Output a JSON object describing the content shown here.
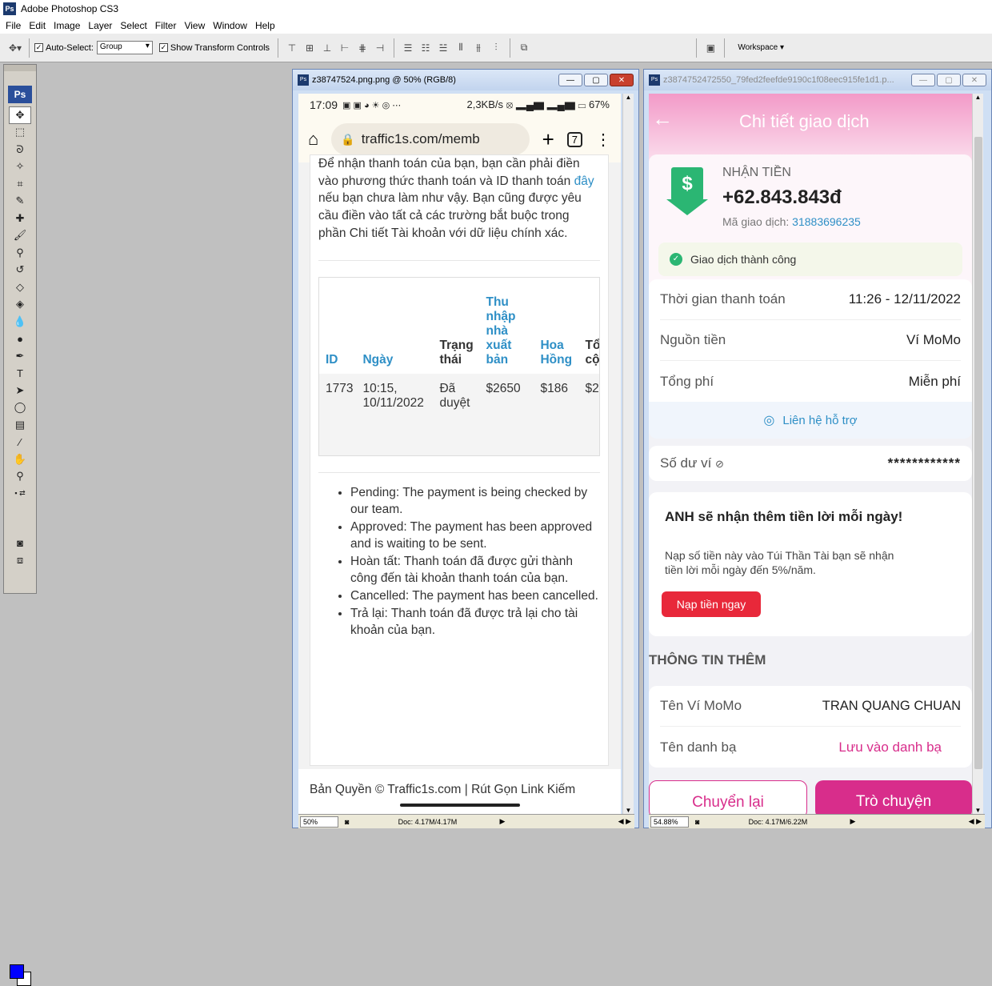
{
  "app": {
    "title": "Adobe Photoshop CS3",
    "logo": "Ps"
  },
  "menu": [
    "File",
    "Edit",
    "Image",
    "Layer",
    "Select",
    "Filter",
    "View",
    "Window",
    "Help"
  ],
  "options": {
    "auto_select_label": "Auto-Select:",
    "auto_select_value": "Group",
    "show_transform_label": "Show Transform Controls",
    "workspace_label": "Workspace ▾"
  },
  "doc1": {
    "title": "z38747524.png.png @ 50% (RGB/8)",
    "zoom": "50%",
    "doc_info": "Doc: 4.17M/4.17M",
    "phone": {
      "time": "17:09",
      "status_right": "2,3KB/s ⦻ ▂▄▆ ▂▄▆ ▭ 67%",
      "url": "traffic1s.com/memb",
      "tabs": "7",
      "intro_1": "Để nhận thanh toán của bạn, bạn cần phải điền vào phương thức thanh toán và ID thanh toán ",
      "intro_link": "đây",
      "intro_2": " nếu bạn chưa làm như vậy. Bạn cũng được yêu cầu điền vào tất cả các trường bắt buộc trong phần Chi tiết Tài khoản với dữ liệu chính xác.",
      "table_headers": [
        "ID",
        "Ngày",
        "Trạng thái",
        "Thu nhập nhà xuất bản",
        "Hoa Hồng",
        "Tổng cộng"
      ],
      "table_row": [
        "1773",
        "10:15, 10/11/2022",
        "Đã duyệt",
        "$2650",
        "$186",
        "$2"
      ],
      "bullets": [
        "Pending: The payment is being checked by our team.",
        "Approved: The payment has been approved and is waiting to be sent.",
        "Hoàn tất: Thanh toán đã được gửi thành công đến tài khoản thanh toán của bạn.",
        "Cancelled: The payment has been cancelled.",
        "Trả lại: Thanh toán đã được trả lại cho tài khoản của bạn."
      ],
      "footer": "Bản Quyền © Traffic1s.com | Rút Gọn Link Kiếm"
    }
  },
  "doc2": {
    "title": "z3874752472550_79fed2feefde9190c1f08eec915fe1d1.p...",
    "zoom": "54.88%",
    "doc_info": "Doc: 4.17M/6.22M",
    "phone": {
      "header_title": "Chi tiết giao dịch",
      "receive_label": "NHẬN TIỀN",
      "amount": "+62.843.843đ",
      "txn_label": "Mã giao dịch:",
      "txn_id": "31883696235",
      "success": "Giao dịch thành công",
      "rows": [
        {
          "label": "Thời gian thanh toán",
          "value": "11:26 - 12/11/2022"
        },
        {
          "label": "Nguồn tiền",
          "value": "Ví MoMo"
        },
        {
          "label": "Tổng phí",
          "value": "Miễn phí"
        }
      ],
      "support": "Liên hệ hỗ trợ",
      "balance_label": "Số dư ví",
      "balance_value": "************",
      "promo_title": "ANH sẽ nhận thêm tiền lời mỗi ngày!",
      "promo_text": "Nạp số tiền này vào Túi Thần Tài bạn sẽ nhận tiền lời mỗi ngày đến 5%/năm.",
      "promo_button": "Nạp tiền ngay",
      "more_title": "THÔNG TIN THÊM",
      "more_rows": [
        {
          "label": "Tên Ví MoMo",
          "value": "TRAN QUANG CHUAN"
        },
        {
          "label": "Tên danh bạ",
          "value": "Lưu vào danh bạ"
        }
      ],
      "btn_left": "Chuyển lại",
      "btn_right": "Trò chuyện"
    }
  },
  "colors": {
    "momo_pink": "#d82d8b",
    "fg_color": "#0000ff",
    "link_blue": "#2e8fc6"
  }
}
